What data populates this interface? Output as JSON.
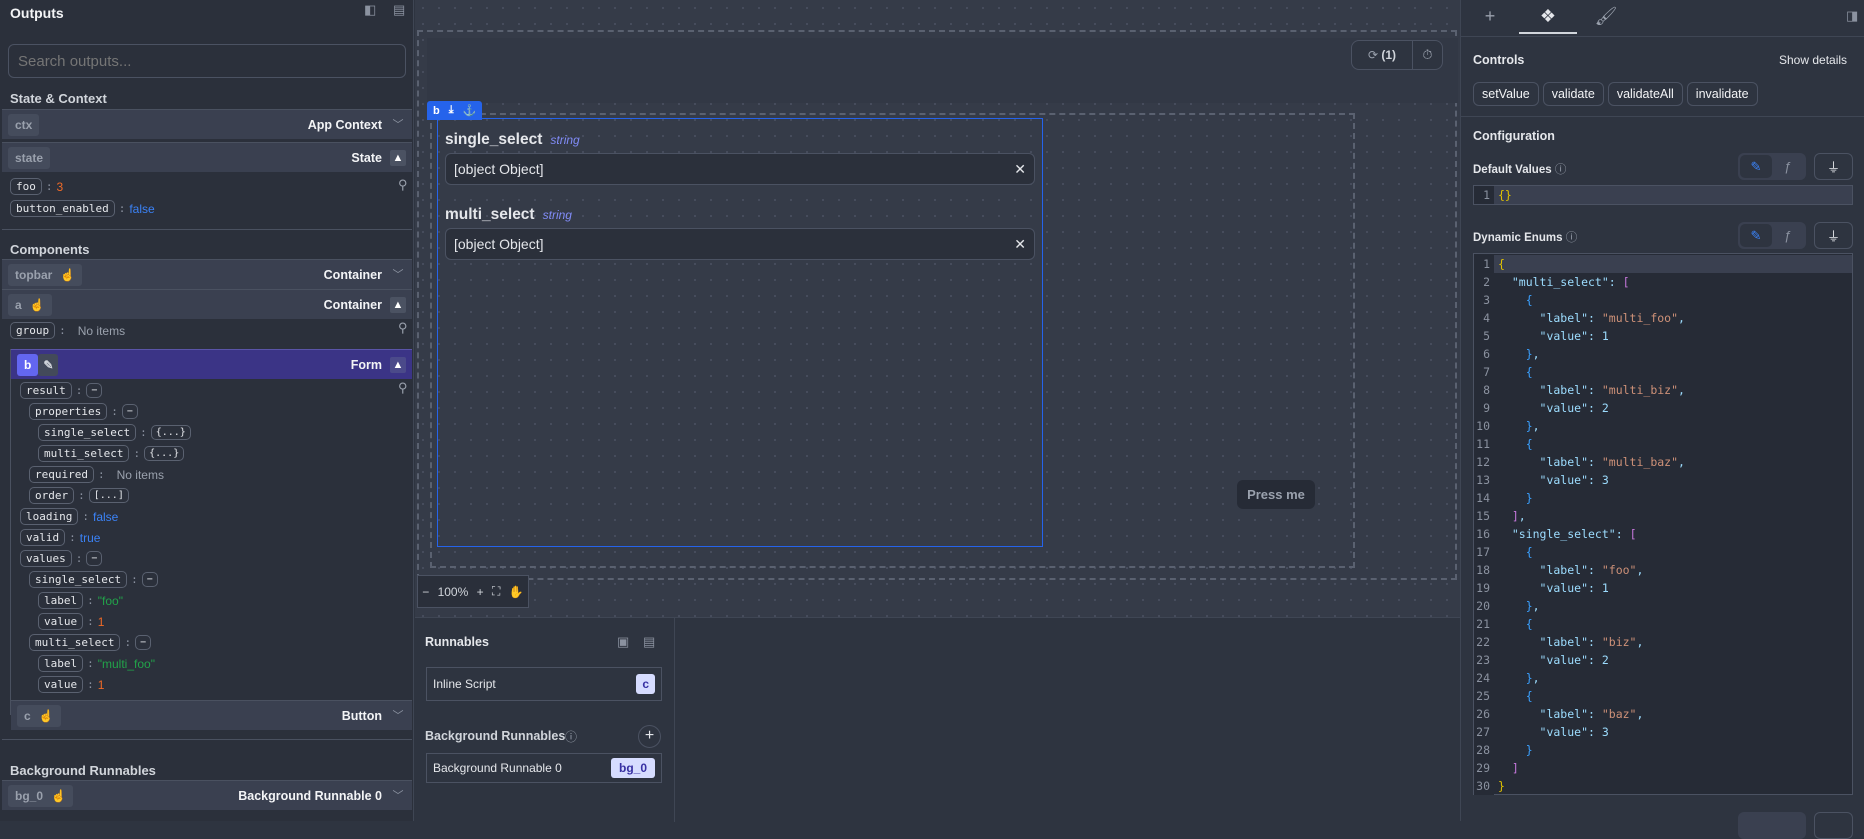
{
  "outputs": {
    "title": "Outputs",
    "search_placeholder": "Search outputs...",
    "state_context_label": "State & Context",
    "ctx": {
      "id": "ctx",
      "type": "App Context"
    },
    "state": {
      "id": "state",
      "type": "State"
    },
    "state_items": [
      {
        "key": "foo",
        "value": "3",
        "kind": "num"
      },
      {
        "key": "button_enabled",
        "value": "false",
        "kind": "bool"
      }
    ],
    "components_label": "Components",
    "topbar": {
      "id": "topbar",
      "type": "Container"
    },
    "a": {
      "id": "a",
      "type": "Container"
    },
    "group": {
      "key": "group",
      "value": "No items"
    },
    "b": {
      "id": "b",
      "type": "Form"
    },
    "b_tree": [
      {
        "key": "result",
        "value": "−",
        "kind": "small",
        "level": 0
      },
      {
        "key": "properties",
        "value": "−",
        "kind": "small",
        "level": 1
      },
      {
        "key": "single_select",
        "value": "{...}",
        "kind": "small",
        "level": 2
      },
      {
        "key": "multi_select",
        "value": "{...}",
        "kind": "small",
        "level": 2
      },
      {
        "key": "required",
        "value": "No items",
        "kind": "muted",
        "level": 1
      },
      {
        "key": "order",
        "value": "[...]",
        "kind": "small",
        "level": 1
      },
      {
        "key": "loading",
        "value": "false",
        "kind": "bool",
        "level": 0
      },
      {
        "key": "valid",
        "value": "true",
        "kind": "bool",
        "level": 0
      },
      {
        "key": "values",
        "value": "−",
        "kind": "small",
        "level": 0
      },
      {
        "key": "single_select",
        "value": "−",
        "kind": "small",
        "level": 1
      },
      {
        "key": "label",
        "value": "\"foo\"",
        "kind": "str",
        "level": 2
      },
      {
        "key": "value",
        "value": "1",
        "kind": "num",
        "level": 2
      },
      {
        "key": "multi_select",
        "value": "−",
        "kind": "small",
        "level": 1
      },
      {
        "key": "label",
        "value": "\"multi_foo\"",
        "kind": "str",
        "level": 2
      },
      {
        "key": "value",
        "value": "1",
        "kind": "num",
        "level": 2
      }
    ],
    "c": {
      "id": "c",
      "type": "Button"
    },
    "background_label": "Background Runnables",
    "bg_0": {
      "id": "bg_0",
      "type": "Background Runnable 0"
    }
  },
  "canvas": {
    "form_tab_label": "b",
    "fields": [
      {
        "label": "single_select",
        "type": "string",
        "value": "[object Object]"
      },
      {
        "label": "multi_select",
        "type": "string",
        "value": "[object Object]"
      }
    ],
    "press_me": "Press me",
    "refresh_count": "(1)",
    "zoom_level": "100%"
  },
  "runnables": {
    "title": "Runnables",
    "items": [
      {
        "name": "Inline Script",
        "badge": "c"
      }
    ],
    "background_title": "Background Runnables",
    "background_items": [
      {
        "name": "Background Runnable 0",
        "badge": "bg_0"
      }
    ]
  },
  "right": {
    "controls_title": "Controls",
    "show_details": "Show details",
    "controls": [
      "setValue",
      "validate",
      "validateAll",
      "invalidate"
    ],
    "configuration_title": "Configuration",
    "default_values_label": "Default Values",
    "default_values_lines": [
      "{}"
    ],
    "dynamic_enums_label": "Dynamic Enums",
    "dynamic_enums_lines": [
      "{",
      "  \"multi_select\": [",
      "    {",
      "      \"label\": \"multi_foo\",",
      "      \"value\": 1",
      "    },",
      "    {",
      "      \"label\": \"multi_biz\",",
      "      \"value\": 2",
      "    },",
      "    {",
      "      \"label\": \"multi_baz\",",
      "      \"value\": 3",
      "    }",
      "  ],",
      "  \"single_select\": [",
      "    {",
      "      \"label\": \"foo\",",
      "      \"value\": 1",
      "    },",
      "    {",
      "      \"label\": \"biz\",",
      "      \"value\": 2",
      "    },",
      "    {",
      "      \"label\": \"baz\",",
      "      \"value\": 3",
      "    }",
      "  ]",
      "}"
    ]
  },
  "colors": {
    "accent": "#2563eb",
    "selected_row": "#3b3486",
    "badge_bg": "#d6dcff"
  }
}
